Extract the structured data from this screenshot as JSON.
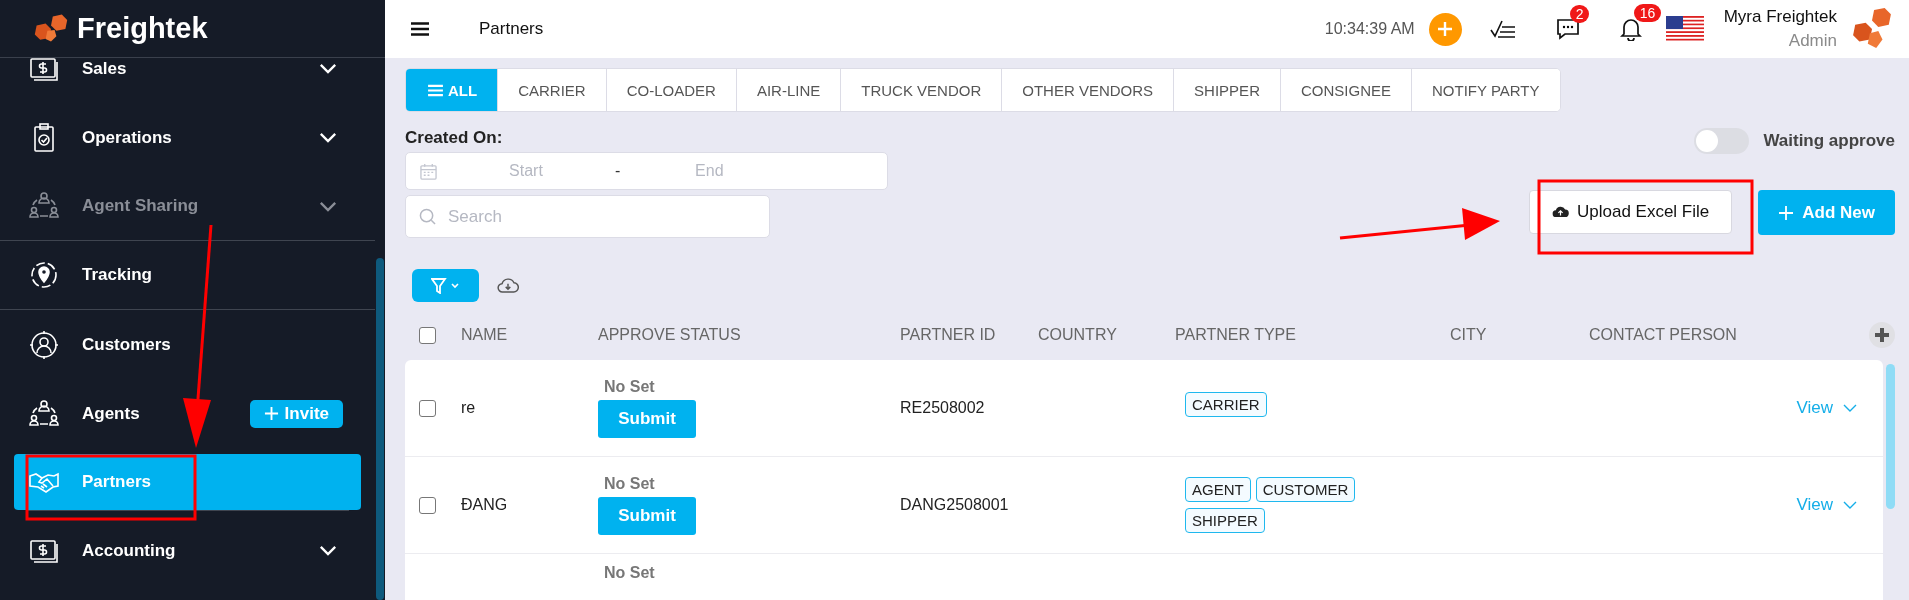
{
  "brand": {
    "name": "Freightek"
  },
  "sidebar": {
    "items": [
      {
        "label": "Sales",
        "kind": "menu",
        "selected": false,
        "disabled": false,
        "divider_after": false
      },
      {
        "label": "Operations",
        "kind": "menu",
        "selected": false,
        "disabled": false,
        "divider_after": false
      },
      {
        "label": "Agent Sharing",
        "kind": "menu",
        "selected": false,
        "disabled": true,
        "divider_after": true
      },
      {
        "label": "Tracking",
        "kind": "link",
        "selected": false,
        "disabled": false,
        "divider_after": true
      },
      {
        "label": "Customers",
        "kind": "link",
        "selected": false,
        "disabled": false,
        "divider_after": false
      },
      {
        "label": "Agents",
        "kind": "action",
        "action": "Invite",
        "selected": false,
        "disabled": false,
        "divider_after": false
      },
      {
        "label": "Partners",
        "kind": "link",
        "selected": true,
        "disabled": false,
        "divider_after": true
      },
      {
        "label": "Accounting",
        "kind": "menu",
        "selected": false,
        "disabled": false,
        "divider_after": false
      }
    ]
  },
  "topbar": {
    "title": "Partners",
    "time": "10:34:39 AM",
    "messages_badge": "2",
    "notifications_badge": "16",
    "user": {
      "name": "Myra Freightek",
      "role": "Admin"
    }
  },
  "tabs": [
    {
      "label": "ALL",
      "selected": true
    },
    {
      "label": "CARRIER",
      "selected": false
    },
    {
      "label": "CO-LOADER",
      "selected": false
    },
    {
      "label": "AIR-LINE",
      "selected": false
    },
    {
      "label": "TRUCK VENDOR",
      "selected": false
    },
    {
      "label": "OTHER VENDORS",
      "selected": false
    },
    {
      "label": "SHIPPER",
      "selected": false
    },
    {
      "label": "CONSIGNEE",
      "selected": false
    },
    {
      "label": "NOTIFY PARTY",
      "selected": false
    }
  ],
  "filters": {
    "created_on_label": "Created On:",
    "start_placeholder": "Start",
    "separator": "-",
    "end_placeholder": "End",
    "search_placeholder": "Search",
    "waiting_approve": {
      "label": "Waiting approve",
      "on": false
    }
  },
  "actions": {
    "upload": "Upload Excel File",
    "add": "Add New"
  },
  "table": {
    "all_selected": false,
    "columns": [
      "NAME",
      "APPROVE STATUS",
      "PARTNER ID",
      "COUNTRY",
      "PARTNER TYPE",
      "CITY",
      "CONTACT PERSON"
    ],
    "rows": [
      {
        "checked": false,
        "name": "re",
        "approve_status": "No Set",
        "submit": "Submit",
        "partner_id": "RE2508002",
        "partner_types": [
          "CARRIER"
        ],
        "view": "View"
      },
      {
        "checked": false,
        "name": "ĐANG",
        "approve_status": "No Set",
        "submit": "Submit",
        "partner_id": "DANG2508001",
        "partner_types": [
          "AGENT",
          "CUSTOMER",
          "SHIPPER"
        ],
        "view": "View"
      },
      {
        "approve_status": "No Set"
      }
    ]
  }
}
